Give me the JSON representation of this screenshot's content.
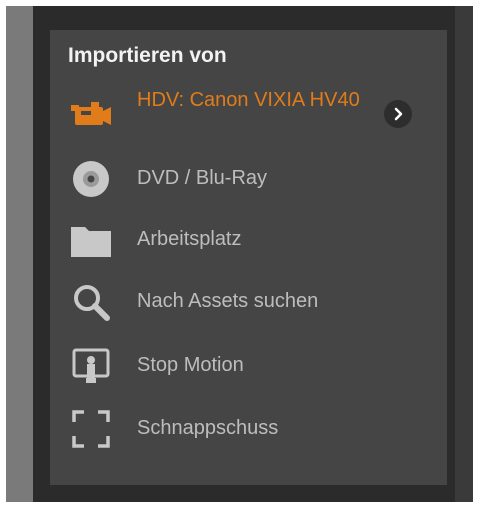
{
  "panel": {
    "title": "Importieren von",
    "items": [
      {
        "label": "HDV: Canon VIXIA HV40",
        "icon": "video-camera-icon",
        "active": true
      },
      {
        "label": "DVD / Blu-Ray",
        "icon": "disc-icon",
        "active": false
      },
      {
        "label": "Arbeitsplatz",
        "icon": "folder-icon",
        "active": false
      },
      {
        "label": "Nach Assets suchen",
        "icon": "search-icon",
        "active": false
      },
      {
        "label": "Stop Motion",
        "icon": "stop-motion-icon",
        "active": false
      },
      {
        "label": "Schnappschuss",
        "icon": "snapshot-icon",
        "active": false
      }
    ]
  },
  "colors": {
    "accent": "#e07c1a",
    "panel_bg": "#454545",
    "text": "#bdbdbd",
    "title": "#f2f2f2"
  }
}
